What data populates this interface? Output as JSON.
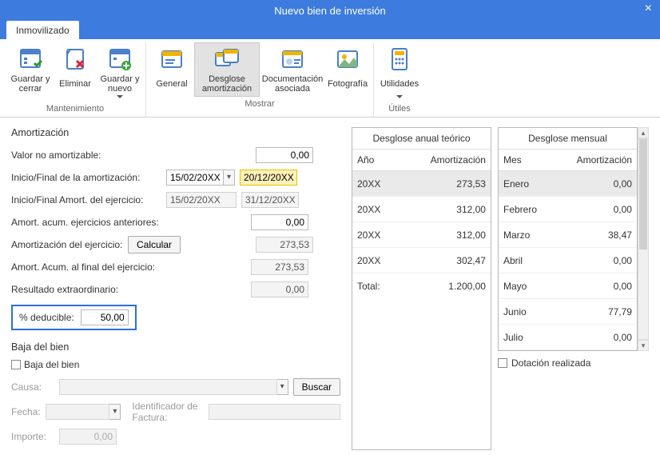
{
  "window": {
    "title": "Nuevo bien de inversión"
  },
  "tabs": {
    "main": "Inmovilizado"
  },
  "ribbon": {
    "groups": [
      {
        "title": "Mantenimiento",
        "buttons": [
          {
            "id": "save-close",
            "label": "Guardar y cerrar"
          },
          {
            "id": "delete",
            "label": "Eliminar"
          },
          {
            "id": "save-new",
            "label": "Guardar y nuevo",
            "caret": true
          }
        ]
      },
      {
        "title": "Mostrar",
        "buttons": [
          {
            "id": "general",
            "label": "General"
          },
          {
            "id": "desglose",
            "label": "Desglose amortización",
            "active": true
          },
          {
            "id": "docs",
            "label": "Documentación asociada"
          },
          {
            "id": "foto",
            "label": "Fotografía"
          }
        ]
      },
      {
        "title": "Útiles",
        "buttons": [
          {
            "id": "utils",
            "label": "Utilidades",
            "caret": true
          }
        ]
      }
    ]
  },
  "amort": {
    "section": "Amortización",
    "valor_no_label": "Valor no amortizable:",
    "valor_no": "0,00",
    "inicio_fin_label": "Inicio/Final de la amortización:",
    "inicio": "15/02/20XX",
    "fin": "20/12/20XX",
    "inicio_fin_ej_label": "Inicio/Final Amort. del ejercicio:",
    "inicio_ej": "15/02/20XX",
    "fin_ej": "31/12/20XX",
    "acum_prev_label": "Amort. acum. ejercicios anteriores:",
    "acum_prev": "0,00",
    "amort_ej_label": "Amortización del ejercicio:",
    "calcular": "Calcular",
    "amort_ej": "273,53",
    "acum_final_label": "Amort. Acum. al final del ejercicio:",
    "acum_final": "273,53",
    "resultado_label": "Resultado extraordinario:",
    "resultado": "0,00",
    "deducible_label": "% deducible:",
    "deducible": "50,00"
  },
  "baja": {
    "section": "Baja del bien",
    "check_label": "Baja del bien",
    "causa_label": "Causa:",
    "buscar": "Buscar",
    "fecha_label": "Fecha:",
    "id_factura_label": "Identificador de Factura:",
    "importe_label": "Importe:",
    "importe": "0,00"
  },
  "annual": {
    "title": "Desglose anual teórico",
    "col1": "Año",
    "col2": "Amortización",
    "rows": [
      {
        "y": "20XX",
        "v": "273,53"
      },
      {
        "y": "20XX",
        "v": "312,00"
      },
      {
        "y": "20XX",
        "v": "312,00"
      },
      {
        "y": "20XX",
        "v": "302,47"
      }
    ],
    "total_label": "Total:",
    "total": "1.200,00"
  },
  "monthly": {
    "title": "Desglose mensual",
    "col1": "Mes",
    "col2": "Amortización",
    "rows": [
      {
        "m": "Enero",
        "v": "0,00"
      },
      {
        "m": "Febrero",
        "v": "0,00"
      },
      {
        "m": "Marzo",
        "v": "38,47"
      },
      {
        "m": "Abril",
        "v": "0,00"
      },
      {
        "m": "Mayo",
        "v": "0,00"
      },
      {
        "m": "Junio",
        "v": "77,79"
      },
      {
        "m": "Julio",
        "v": "0,00"
      }
    ]
  },
  "dotacion_label": "Dotación realizada"
}
